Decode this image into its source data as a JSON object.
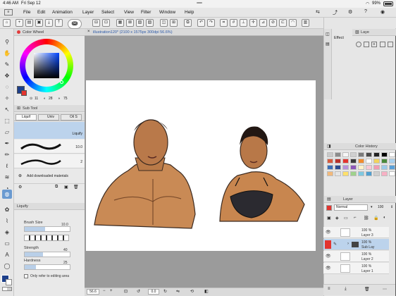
{
  "status": {
    "time": "4:46 AM",
    "date": "Fri Sep 12",
    "battery": "99%"
  },
  "menu": [
    "File",
    "Edit",
    "Animation",
    "Layer",
    "Select",
    "View",
    "Filter",
    "Window",
    "Help"
  ],
  "document_tab": {
    "title": "illustration120* (2100 x 1575px 300dpi 56.6%)"
  },
  "color_wheel": {
    "title": "Color Wheel",
    "h": "11",
    "s": "28",
    "v": "75",
    "main_color": "#1d3f8a",
    "sub_color": "#e3342f"
  },
  "sub_tool": {
    "title": "Sub Tool",
    "tabs": [
      "Liquif",
      "Univ",
      "Oil S"
    ],
    "brushes": [
      {
        "name": "Liquify",
        "size": ""
      },
      {
        "name": "",
        "size": "10.0"
      },
      {
        "name": "",
        "size": "2"
      }
    ],
    "add_materials": "Add downloaded materials"
  },
  "tool_property": {
    "title": "Liquify",
    "brush_size_label": "Brush Size",
    "brush_size_value": "10.0",
    "brush_size_pct": 0.45,
    "strength_label": "Strength",
    "strength_value": "40",
    "strength_pct": 0.4,
    "hardness_label": "Hardness",
    "hardness_value": "25",
    "hardness_pct": 0.25,
    "only_refer_label": "Only refer to editing area"
  },
  "effect_panel": {
    "title": "Effect"
  },
  "layer_panel_top": {
    "title": "Laye"
  },
  "color_history": {
    "title": "Color History",
    "colors": [
      "#c9c9c9",
      "#8c8c8c",
      "#f6f6f6",
      "#d0d0d0",
      "#7a7a7a",
      "#4a4a4a",
      "#232323",
      "#000000",
      "#ffffff",
      "#d65a3e",
      "#b8322a",
      "#e3342f",
      "#3a3a3a",
      "#f28d2e",
      "#ffffff",
      "#f3d35c",
      "#4a8a3b",
      "#a9d1ef",
      "#3b6fb6",
      "#2b4b8f",
      "#b892d9",
      "#8c56b8",
      "#fff2c9",
      "#f8c8d6",
      "#f29cb1",
      "#9ccbe8",
      "#5aa0d8",
      "#f2b97b",
      "#e5e5e5",
      "#ffe06b",
      "#9fd28c",
      "#7fc8e0",
      "#4f9fd0",
      "#cfcfcf",
      "#f8b0c4",
      "#ffffff"
    ]
  },
  "layer_panel": {
    "title": "Layer",
    "blend_mode": "Normal",
    "opacity": "100",
    "layers": [
      {
        "opacity": "100 %",
        "name": "Layer 3",
        "selected": false
      },
      {
        "opacity": "100 %",
        "name": "Sub Lay",
        "selected": true
      },
      {
        "opacity": "100 %",
        "name": "Layer 2",
        "selected": false
      },
      {
        "opacity": "100 %",
        "name": "Layer 1",
        "selected": false
      }
    ]
  },
  "bottom_bar": {
    "zoom": "56.6",
    "rotation": "0.0"
  }
}
